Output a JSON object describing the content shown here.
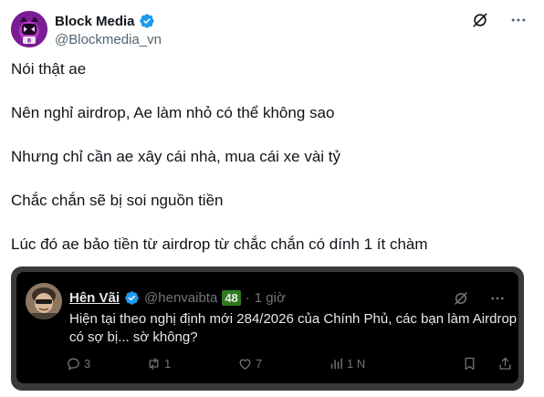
{
  "post": {
    "author": {
      "display_name": "Block Media",
      "handle": "@Blockmedia_vn",
      "verified": true
    },
    "paragraphs": [
      "Nói thật ae",
      "Nên nghỉ airdrop, Ae làm nhỏ có thể không sao",
      "Nhưng chỉ cần ae xây cái nhà, mua cái xe vài tỷ",
      "Chắc chắn sẽ bị soi nguồn tiền",
      "Lúc đó ae bảo tiền từ airdrop từ chắc chắn có dính 1 ít chàm"
    ]
  },
  "quote": {
    "author": {
      "display_name": "Hên Vãi",
      "handle": "@henvaibta",
      "badge": "48",
      "separator": "·",
      "time": "1 giờ"
    },
    "text_lines": [
      "Hiện tại theo nghị định mới 284/2026 của Chính Phủ, các bạn làm Airdrop",
      "có sợ bị... sờ không?"
    ],
    "stats": {
      "replies": "3",
      "reposts": "1",
      "likes": "7",
      "views": "1 N"
    }
  },
  "colors": {
    "verified": "#1d9bf0",
    "badge_bg": "#2f7a1f",
    "quote_frame": "#3a3a3a",
    "quote_bg": "#000000"
  },
  "icons": {
    "top_actions": [
      "grok-icon",
      "more-icon"
    ],
    "quote_top_actions": [
      "grok-icon",
      "more-icon"
    ],
    "quote_footer": [
      "reply-icon",
      "repost-icon",
      "like-icon",
      "views-icon",
      "bookmark-icon",
      "share-icon"
    ]
  }
}
